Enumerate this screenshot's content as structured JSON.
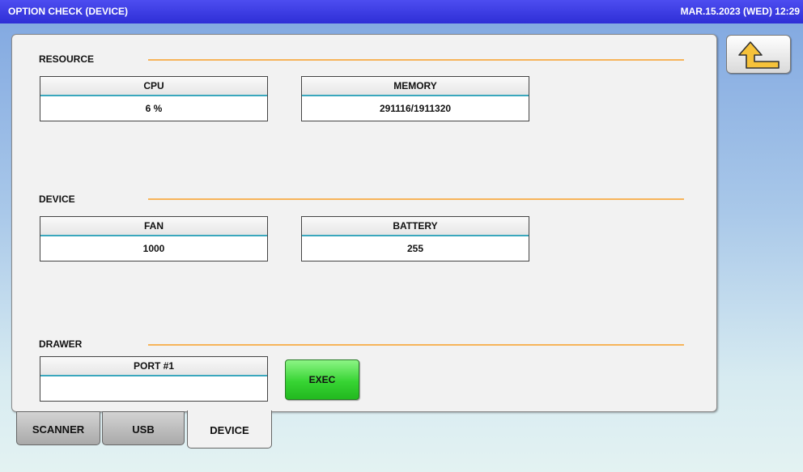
{
  "header": {
    "title": "OPTION CHECK (DEVICE)",
    "datetime": "MAR.15.2023 (WED)  12:29"
  },
  "sections": {
    "resource": {
      "title": "RESOURCE",
      "cpu": {
        "label": "CPU",
        "value": "6 %"
      },
      "memory": {
        "label": "MEMORY",
        "value": "291116/1911320"
      }
    },
    "device": {
      "title": "DEVICE",
      "fan": {
        "label": "FAN",
        "value": "1000"
      },
      "battery": {
        "label": "BATTERY",
        "value": "255"
      }
    },
    "drawer": {
      "title": "DRAWER",
      "port1": {
        "label": "PORT #1",
        "value": ""
      },
      "exec_label": "EXEC"
    }
  },
  "tabs": [
    {
      "label": "SCANNER",
      "active": false
    },
    {
      "label": "USB",
      "active": false
    },
    {
      "label": "DEVICE",
      "active": true
    }
  ],
  "icons": {
    "back": "return-arrow-icon"
  },
  "colors": {
    "titlebar": "#3535e0",
    "section_line": "#f7b45a",
    "field_underline": "#3aa7bd",
    "exec_button": "#37d433"
  }
}
